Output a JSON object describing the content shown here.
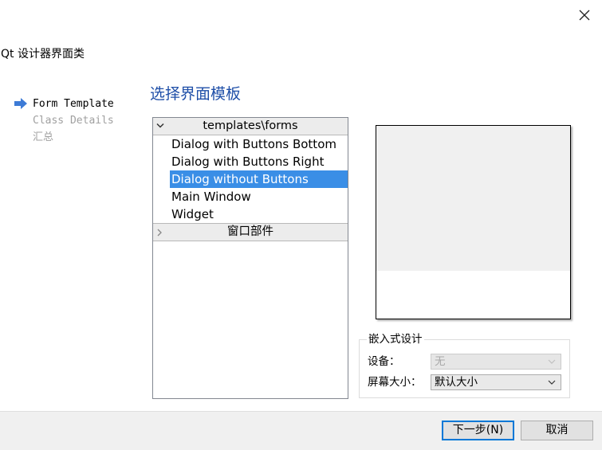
{
  "window": {
    "title": "Qt 设计器界面类"
  },
  "steps": [
    {
      "label": "Form Template",
      "state": "active"
    },
    {
      "label": "Class Details",
      "state": "inactive"
    },
    {
      "label": "汇总",
      "state": "inactive"
    }
  ],
  "page": {
    "heading": "选择界面模板"
  },
  "templates": {
    "groups": [
      {
        "label": "templates\\forms",
        "expanded": true,
        "items": [
          "Dialog with Buttons Bottom",
          "Dialog with Buttons Right",
          "Dialog without Buttons",
          "Main Window",
          "Widget"
        ],
        "selected": "Dialog without Buttons"
      },
      {
        "label": "窗口部件",
        "expanded": false
      }
    ]
  },
  "embedded": {
    "title": "嵌入式设计",
    "device_label": "设备：",
    "device_value": "无",
    "screen_label": "屏幕大小：",
    "screen_value": "默认大小"
  },
  "buttons": {
    "next": "下一步(N)",
    "cancel": "取消"
  },
  "colors": {
    "heading": "#1f4fa8",
    "selection": "#3a8ee6",
    "arrow": "#3d7bd6",
    "default_button_border": "#0078d7"
  }
}
